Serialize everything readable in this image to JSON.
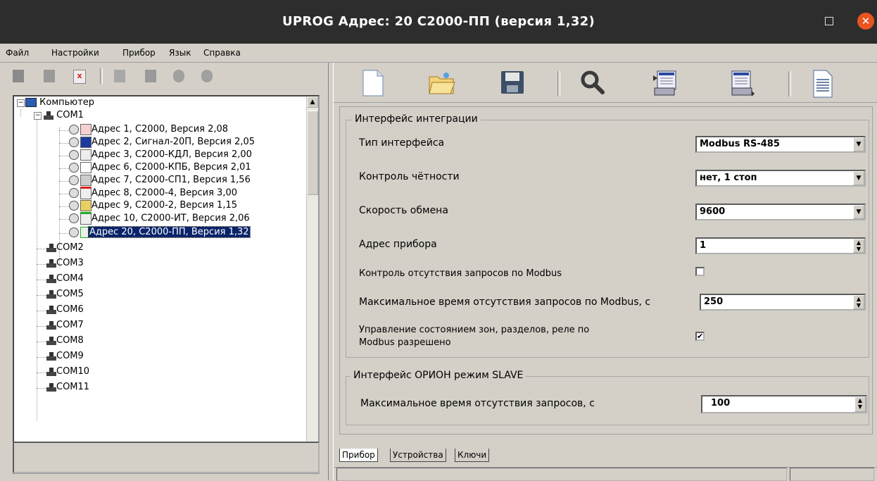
{
  "window": {
    "title": "UPROG Адрес:  20  С2000-ПП (версия  1,32)"
  },
  "menu": [
    "Файл",
    "Настройки",
    "Прибор",
    "Язык",
    "Справка"
  ],
  "tree": {
    "root": "Компьютер",
    "com1": "COM1",
    "devices": [
      "Адрес 1, С2000, Версия 2,08",
      "Адрес 2, Сигнал-20П, Версия 2,05",
      "Адрес 3, С2000-КДЛ, Версия 2,00",
      "Адрес 6, С2000-КПБ, Версия 2,01",
      "Адрес 7, С2000-СП1, Версия 1,56",
      "Адрес 8, С2000-4, Версия 3,00",
      "Адрес 9, С2000-2, Версия 1,15",
      "Адрес 10, С2000-ИТ, Версия 2,06",
      "Адрес 20, С2000-ПП, Версия 1,32"
    ],
    "ports": [
      "COM2",
      "COM3",
      "COM4",
      "COM5",
      "COM6",
      "COM7",
      "COM8",
      "COM9",
      "COM10",
      "COM11"
    ]
  },
  "integration": {
    "legend": "Интерфейс интеграции",
    "interface_type_label": "Тип интерфейса",
    "interface_type_value": "Modbus RS-485",
    "parity_label": "Контроль чётности",
    "parity_value": "нет, 1 стоп",
    "speed_label": "Скорость обмена",
    "speed_value": "9600",
    "address_label": "Адрес прибора",
    "address_value": "1",
    "absence_check_label": "Контроль отсутствия запросов по Modbus",
    "absence_check_checked": false,
    "max_time_label": "Максимальное время отсутствия запросов по Modbus, с",
    "max_time_value": "250",
    "control_label_line1": "Управление состоянием зон, разделов, реле по",
    "control_label_line2": "Modbus разрешено",
    "control_checked": true,
    "checkmark": "✔"
  },
  "orion": {
    "legend": "Интерфейс ОРИОН режим SLAVE",
    "max_time_label": "Максимальное время отсутствия запросов, с",
    "max_time_value": "100"
  },
  "tabs": [
    "Прибор",
    "Устройства",
    "Ключи"
  ],
  "glyphs": {
    "close": "✕",
    "down": "▼",
    "up": "▲",
    "minus": "−",
    "plus": "+"
  }
}
